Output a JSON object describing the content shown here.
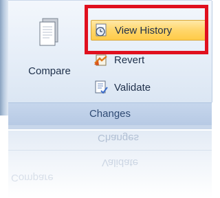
{
  "ribbon": {
    "group_label": "Changes",
    "buttons": {
      "compare": {
        "label": "Compare",
        "icon": "compare-document-icon"
      },
      "view_history": {
        "label": "View History",
        "icon": "view-history-icon",
        "state": "hover"
      },
      "revert": {
        "label": "Revert",
        "icon": "revert-icon"
      },
      "validate": {
        "label": "Validate",
        "icon": "validate-icon"
      }
    }
  },
  "reflection": {
    "group_label": "Changes",
    "validate_label": "Validate",
    "compare_label": "Compare"
  },
  "annotation": {
    "highlight_color": "#e0101e"
  },
  "colors": {
    "hover_fill": "#ffd66b",
    "ribbon_bg": "#dbe6f4",
    "label_text": "#1e2f4a"
  }
}
